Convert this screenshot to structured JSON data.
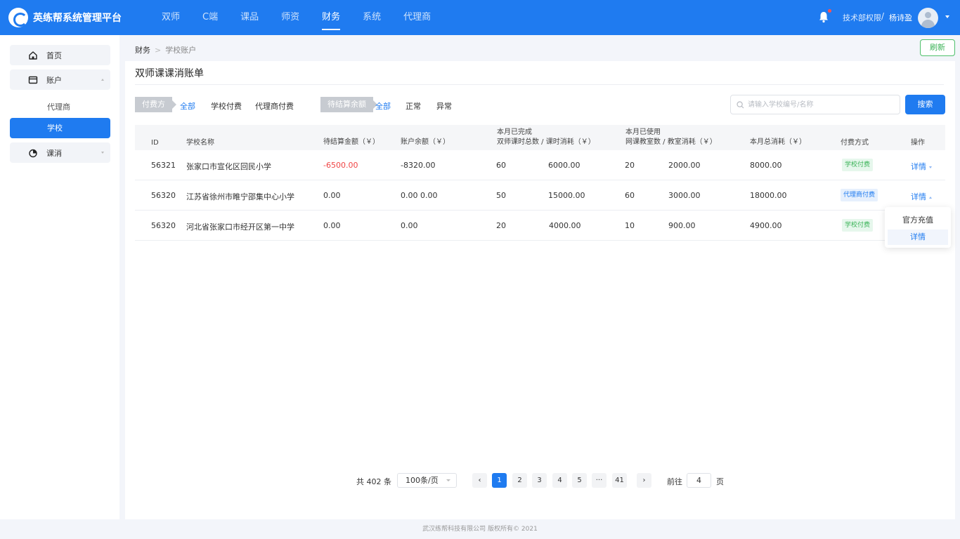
{
  "app": {
    "title": "英练帮系统管理平台"
  },
  "nav": [
    "双师",
    "C端",
    "课品",
    "师资",
    "财务",
    "系统",
    "代理商"
  ],
  "nav_active": "财务",
  "user": {
    "dept": "技术部权限",
    "separator": "/",
    "name": "杨诗盈"
  },
  "sidebar": {
    "home": "首页",
    "account": "账户",
    "agent": "代理商",
    "school": "学校",
    "consume": "课消"
  },
  "breadcrumb": {
    "root": "财务",
    "sep": ">",
    "current": "学校账户"
  },
  "refresh_label": "刷新",
  "page_title": "双师课课消账单",
  "filters": {
    "payer": {
      "label": "付费方",
      "options": [
        "全部",
        "学校付费",
        "代理商付费"
      ],
      "active": "全部"
    },
    "balance": {
      "label": "待结算余额",
      "options": [
        "全部",
        "正常",
        "异常"
      ],
      "active": "全部"
    }
  },
  "search": {
    "placeholder": "请输入学校编号/名称",
    "button": "搜索"
  },
  "table": {
    "headers": {
      "id": "ID",
      "name": "学校名称",
      "pending": "待结算金额（￥）",
      "balance": "账户余额（￥）",
      "done_top": "本月已完成",
      "done_bottom": "双师课时总数 / 课时消耗（￥）",
      "used_top": "本月已使用",
      "used_bottom": "网课教室数 / 教室消耗（￥）",
      "total": "本月总消耗（￥）",
      "pay": "付费方式",
      "op": "操作"
    },
    "rows": [
      {
        "id": "56321",
        "name": "张家口市宣化区回民小学",
        "pending": "-6500.00",
        "balance": "-8320.00",
        "hours": "60",
        "hour_cost": "6000.00",
        "rooms": "20",
        "room_cost": "2000.00",
        "total": "8000.00",
        "pay": "学校付费",
        "op": "详情"
      },
      {
        "id": "56320",
        "name": "江苏省徐州市睢宁邵集中心小学",
        "pending": "0.00",
        "balance": "0.00 0.00",
        "hours": "50",
        "hour_cost": "15000.00",
        "rooms": "60",
        "room_cost": "3000.00",
        "total": "18000.00",
        "pay": "代理商付费",
        "op": "详情"
      },
      {
        "id": "56320",
        "name": "河北省张家口市经开区第一中学",
        "pending": "0.00",
        "balance": "0.00",
        "hours": "20",
        "hour_cost": "4000.00",
        "rooms": "10",
        "room_cost": "900.00",
        "total": "4900.00",
        "pay": "学校付费",
        "op": "详情"
      }
    ]
  },
  "dropdown": [
    "官方充值",
    "详情"
  ],
  "pagination": {
    "total": "共 402 条",
    "page_size": "100条/页",
    "prev": "‹",
    "next": "›",
    "pages": [
      "1",
      "2",
      "3",
      "4",
      "5",
      "···",
      "41"
    ],
    "current": "1",
    "goto_label": "前往",
    "goto_value": "4",
    "page_suffix": "页"
  },
  "footer": "武汉练帮科技有限公司 版权所有© 2021",
  "colors": {
    "primary": "#1f7bf0",
    "danger": "#f04545",
    "success": "#3bb357"
  }
}
